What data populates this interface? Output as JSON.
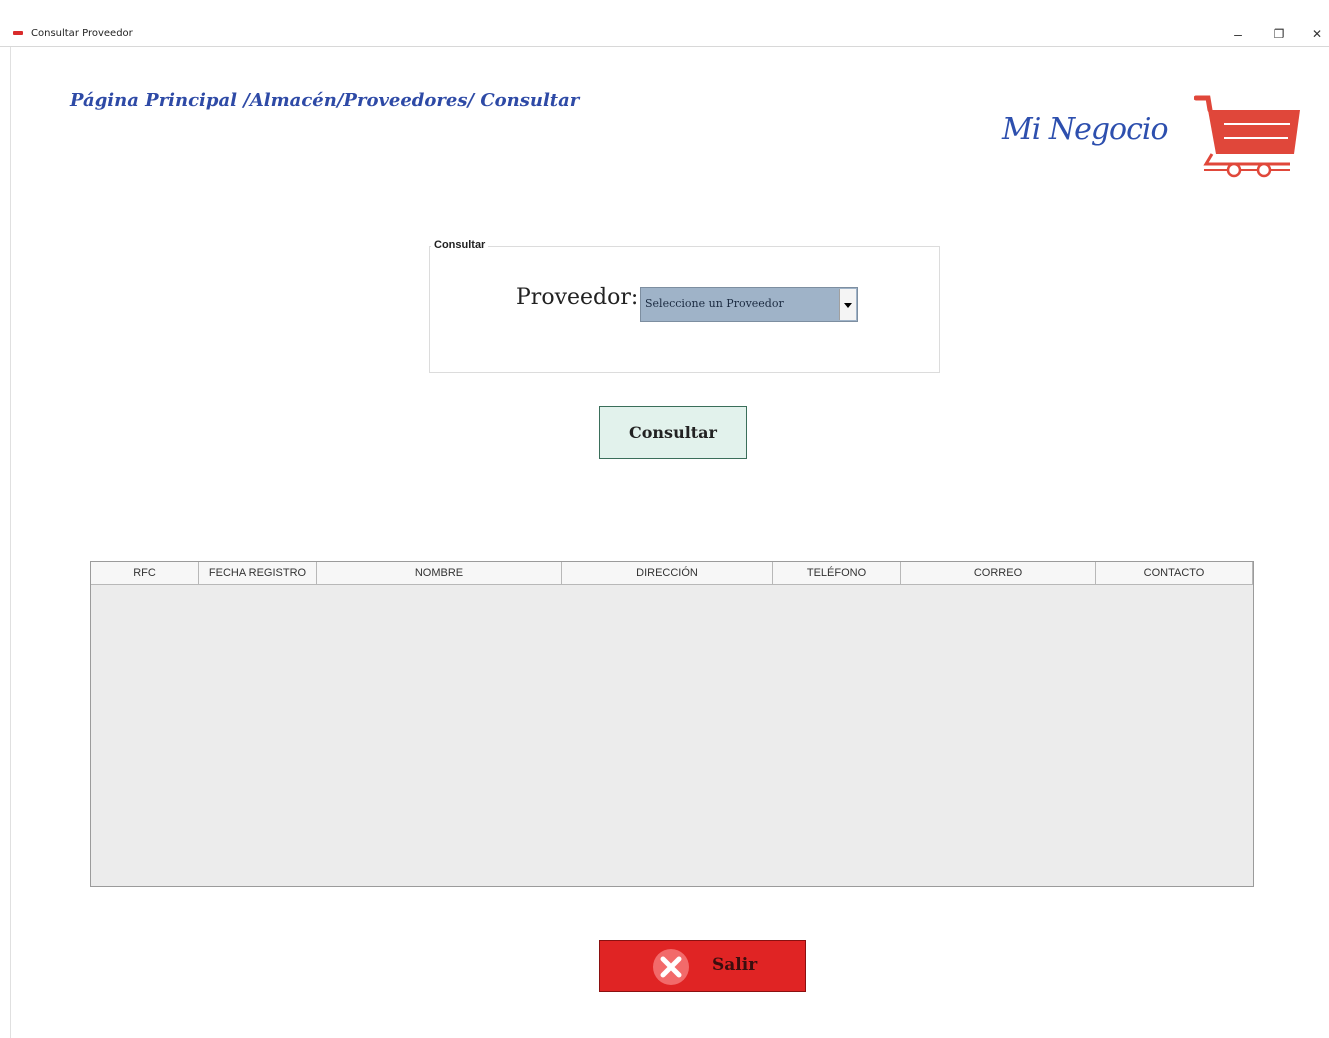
{
  "window": {
    "title": "Consultar Proveedor",
    "controls": {
      "minimize": "–",
      "restore": "❐",
      "close": "✕"
    }
  },
  "breadcrumb": {
    "items": [
      "Página Principal",
      "Almacén",
      "Proveedores",
      "Consultar"
    ],
    "separators": [
      " /",
      "/",
      "/ "
    ]
  },
  "logo": {
    "text": "Mi Negocio",
    "icon": "shopping-cart-icon",
    "color": "#e0473a"
  },
  "group": {
    "legend": "Consultar",
    "label": "Proveedor:",
    "combo": {
      "selected": "Seleccione un Proveedor"
    }
  },
  "consultar_button": {
    "label": "Consultar"
  },
  "table": {
    "columns": [
      {
        "label": "RFC"
      },
      {
        "label": "FECHA REGISTRO"
      },
      {
        "label": "NOMBRE"
      },
      {
        "label": "DIRECCIÓN"
      },
      {
        "label": "TELÉFONO"
      },
      {
        "label": "CORREO"
      },
      {
        "label": "CONTACTO"
      }
    ],
    "rows": []
  },
  "salir_button": {
    "label": "Salir",
    "icon": "close-circle-icon"
  },
  "colors": {
    "breadcrumb": "#2e4aa6",
    "combo_bg": "#9fb3c8",
    "consultar_bg": "#e2f2ec",
    "salir_bg": "#e02424"
  }
}
